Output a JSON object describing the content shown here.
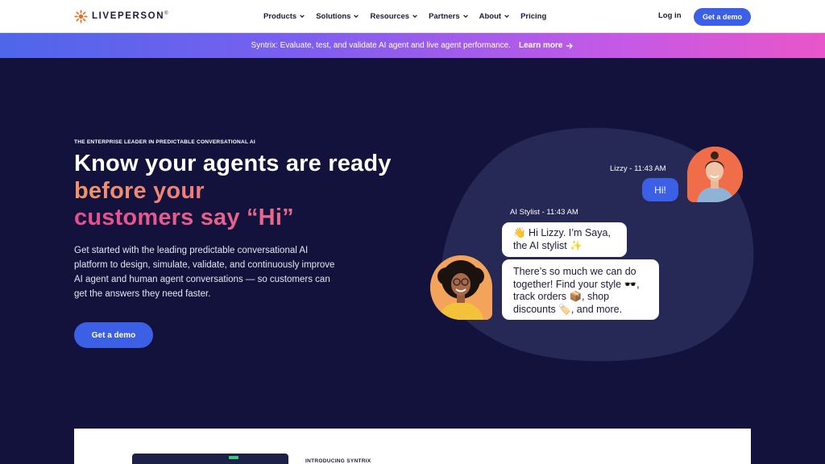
{
  "nav": {
    "logo_text": "LIVEPERSON",
    "logo_mark": "®",
    "menu": [
      {
        "label": "Products",
        "dropdown": true
      },
      {
        "label": "Solutions",
        "dropdown": true
      },
      {
        "label": "Resources",
        "dropdown": true
      },
      {
        "label": "Partners",
        "dropdown": true
      },
      {
        "label": "About",
        "dropdown": true
      },
      {
        "label": "Pricing",
        "dropdown": false
      }
    ],
    "login_label": "Log in",
    "demo_label": "Get a demo"
  },
  "banner": {
    "text": "Syntrix: Evaluate, test, and validate AI agent and live agent performance.",
    "link_label": "Learn more"
  },
  "hero": {
    "eyebrow": "THE ENTERPRISE LEADER IN PREDICTABLE CONVERSATIONAL AI",
    "headline_part1": "Know your agents are ready ",
    "headline_part2": "before your",
    "headline_part3": "customers say “Hi”",
    "subtext": "Get started with the leading predictable conversational AI platform to design, simulate, validate, and continuously improve AI agent and human agent conversations — so customers can get the answers they need faster.",
    "cta_label": "Get a demo"
  },
  "chat": {
    "lizzy_meta": "Lizzy - 11:43 AM",
    "lizzy_message": "Hi!",
    "ai_meta": "AI Stylist - 11:43 AM",
    "ai_message_1": "👋 Hi Lizzy. I’m Saya, the AI stylist ✨",
    "ai_message_2": "There’s so much we can do together! Find your style 🕶️, track orders 📦, shop discounts 🏷️, and more."
  },
  "card": {
    "label": "INTRODUCING SYNTRIX"
  },
  "colors": {
    "background": "#12123c",
    "accent": "#3b5fe5",
    "blob": "#262855",
    "gradient_orange": "#f0956a",
    "gradient_pink": "#e74e8f"
  }
}
